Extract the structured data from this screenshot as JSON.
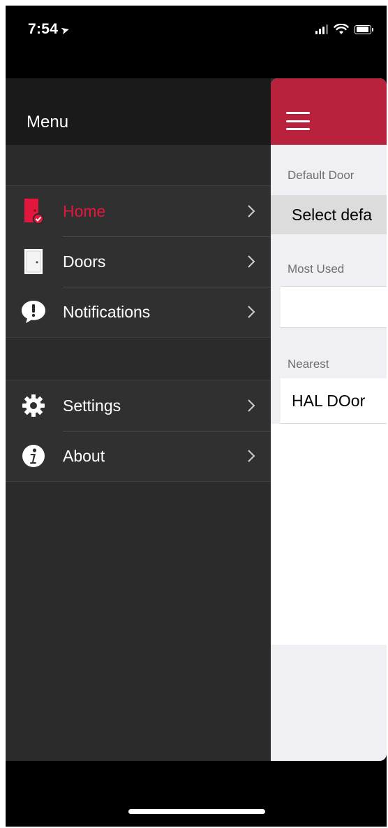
{
  "status_bar": {
    "time": "7:54",
    "location_glyph": "➤"
  },
  "menu": {
    "title": "Menu",
    "primary_items": [
      {
        "label": "Home",
        "icon": "home-door-icon",
        "active": true
      },
      {
        "label": "Doors",
        "icon": "door-icon",
        "active": false
      },
      {
        "label": "Notifications",
        "icon": "alert-bubble-icon",
        "active": false
      }
    ],
    "secondary_items": [
      {
        "label": "Settings",
        "icon": "gear-icon",
        "active": false
      },
      {
        "label": "About",
        "icon": "info-icon",
        "active": false
      }
    ]
  },
  "main": {
    "default_door_label": "Default Door",
    "select_default_text": "Select defa",
    "most_used_label": "Most Used",
    "nearest_label": "Nearest",
    "nearest_item": "HAL DOor"
  },
  "colors": {
    "accent": "#e3173e",
    "header_red": "#b8223c",
    "menu_bg": "#2b2b2b"
  }
}
